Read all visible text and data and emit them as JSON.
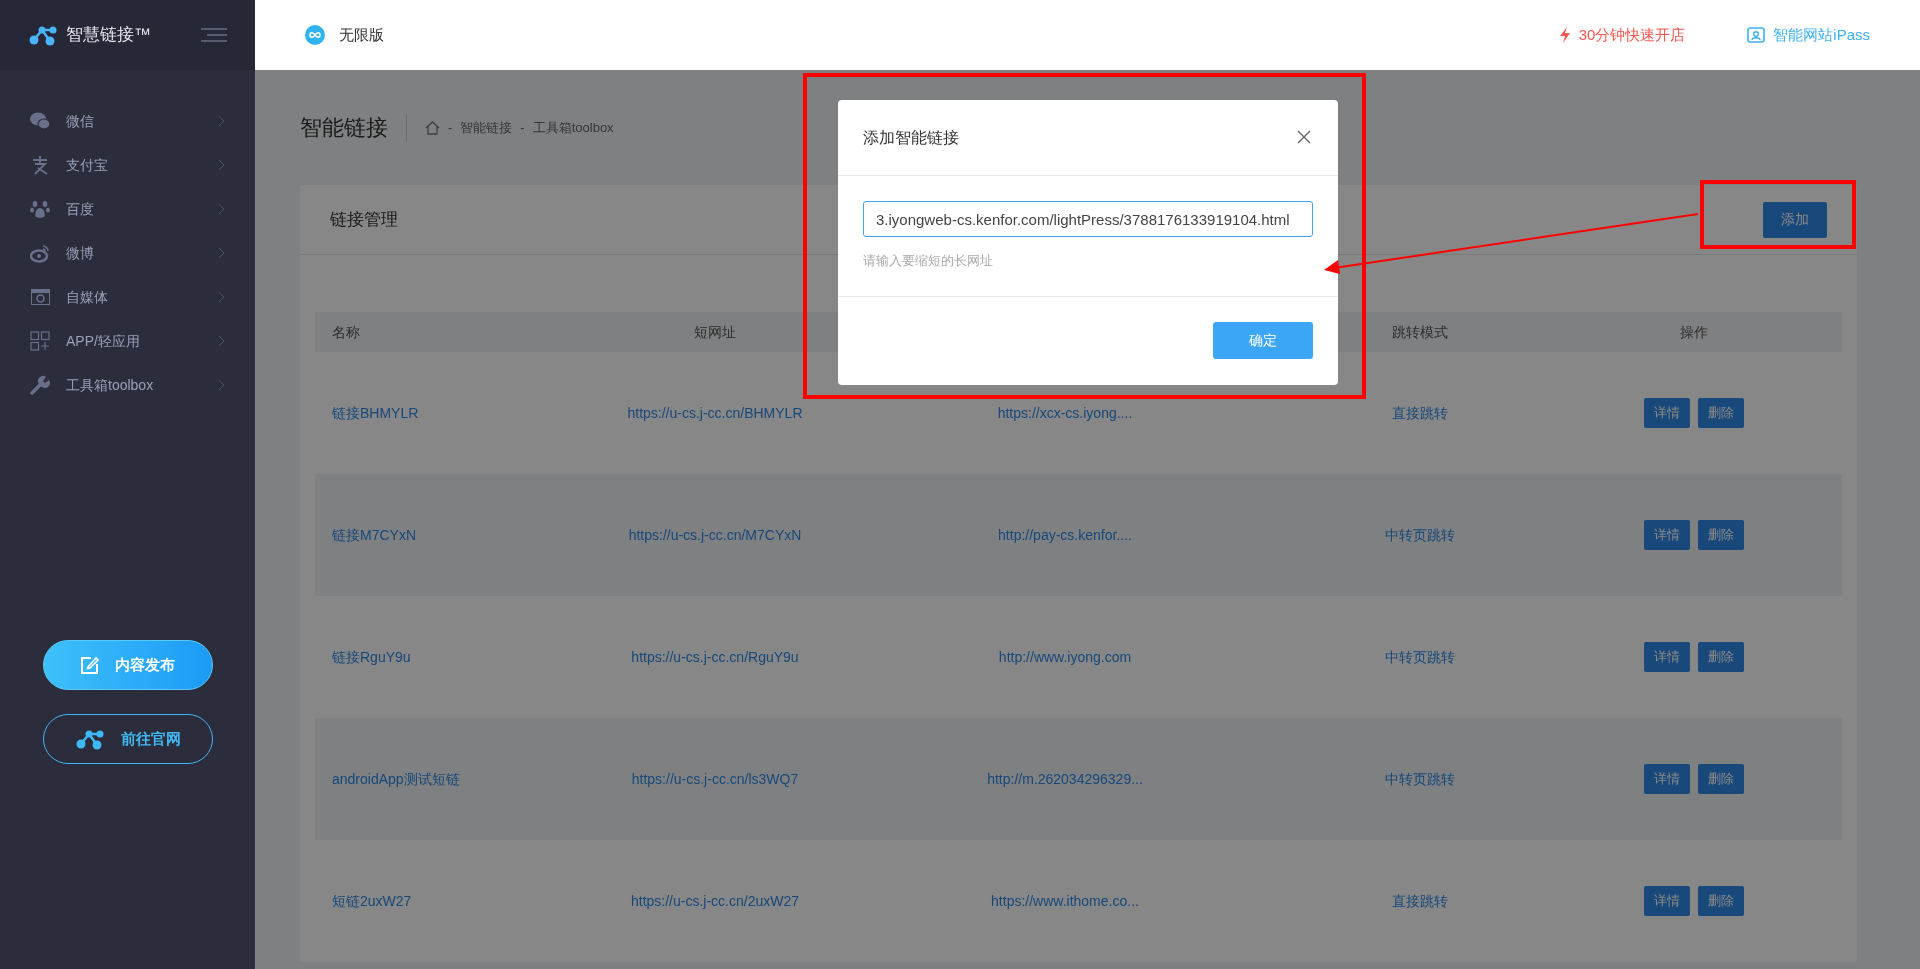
{
  "sidebar": {
    "logo": "智慧链接™",
    "items": [
      {
        "label": "微信",
        "kind": "wechat"
      },
      {
        "label": "支付宝",
        "kind": "alipay"
      },
      {
        "label": "百度",
        "kind": "baidu"
      },
      {
        "label": "微博",
        "kind": "weibo"
      },
      {
        "label": "自媒体",
        "kind": "media"
      },
      {
        "label": "APP/轻应用",
        "kind": "app"
      },
      {
        "label": "工具箱toolbox",
        "kind": "tools"
      }
    ],
    "buttons": [
      {
        "label": "内容发布",
        "kind": "filled"
      },
      {
        "label": "前往官网",
        "kind": "outline"
      }
    ]
  },
  "header": {
    "edition": "无限版",
    "links": [
      {
        "label": "30分钟快速开店",
        "kind": "promo"
      },
      {
        "label": "智能网站iPass",
        "kind": "site"
      }
    ]
  },
  "page": {
    "title": "智能链接",
    "breadcrumb": [
      {
        "separator": "-",
        "label": "智能链接"
      },
      {
        "separator": "-",
        "label": "工具箱toolbox"
      }
    ]
  },
  "card": {
    "title": "链接管理",
    "add_button": "添加",
    "columns": {
      "name": "名称",
      "short_url": "短网址",
      "mode": "跳转模式",
      "actions": "操作"
    },
    "rows": [
      {
        "name": "链接BHMYLR",
        "short_url": "https://u-cs.j-cc.cn/BHMYLR",
        "column_3": "https://xcx-cs.iyong....",
        "mode": "直接跳转",
        "actions": [
          "详情",
          "删除"
        ]
      },
      {
        "name": "链接M7CYxN",
        "short_url": "https://u-cs.j-cc.cn/M7CYxN",
        "column_3": "http://pay-cs.kenfor....",
        "mode": "中转页跳转",
        "actions": [
          "详情",
          "删除"
        ]
      },
      {
        "name": "链接RguY9u",
        "short_url": "https://u-cs.j-cc.cn/RguY9u",
        "column_3": "http://www.iyong.com",
        "mode": "中转页跳转",
        "actions": [
          "详情",
          "删除"
        ]
      },
      {
        "name": "androidApp测试短链",
        "short_url": "https://u-cs.j-cc.cn/ls3WQ7",
        "column_3": "http://m.262034296329...",
        "mode": "中转页跳转",
        "actions": [
          "详情",
          "删除"
        ]
      },
      {
        "name": "短链2uxW27",
        "short_url": "https://u-cs.j-cc.cn/2uxW27",
        "column_3": "https://www.ithome.co...",
        "mode": "直接跳转",
        "actions": [
          "详情",
          "删除"
        ]
      }
    ]
  },
  "modal": {
    "title": "添加智能链接",
    "url_value": "3.iyongweb-cs.kenfor.com/lightPress/3788176133919104.html",
    "hint": "请输入要缩短的长网址",
    "confirm": "确定"
  }
}
